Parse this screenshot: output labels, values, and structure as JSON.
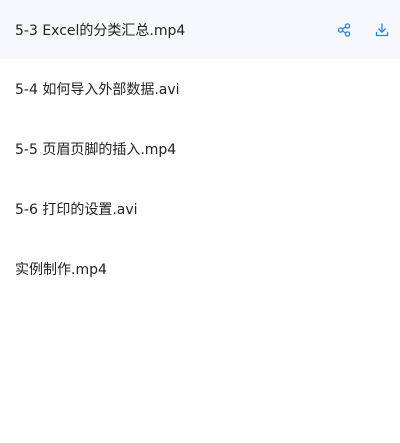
{
  "colors": {
    "accent": "#2b7fe8",
    "active_row_bg": "#f6f8fc",
    "text": "#222222"
  },
  "files": [
    {
      "name": "5-3 Excel的分类汇总.mp4",
      "active": true
    },
    {
      "name": "5-4 如何导入外部数据.avi",
      "active": false
    },
    {
      "name": "5-5 页眉页脚的插入.mp4",
      "active": false
    },
    {
      "name": "5-6 打印的设置.avi",
      "active": false
    },
    {
      "name": "实例制作.mp4",
      "active": false
    }
  ],
  "row_actions": {
    "share_icon": "share-icon",
    "download_icon": "download-icon"
  }
}
